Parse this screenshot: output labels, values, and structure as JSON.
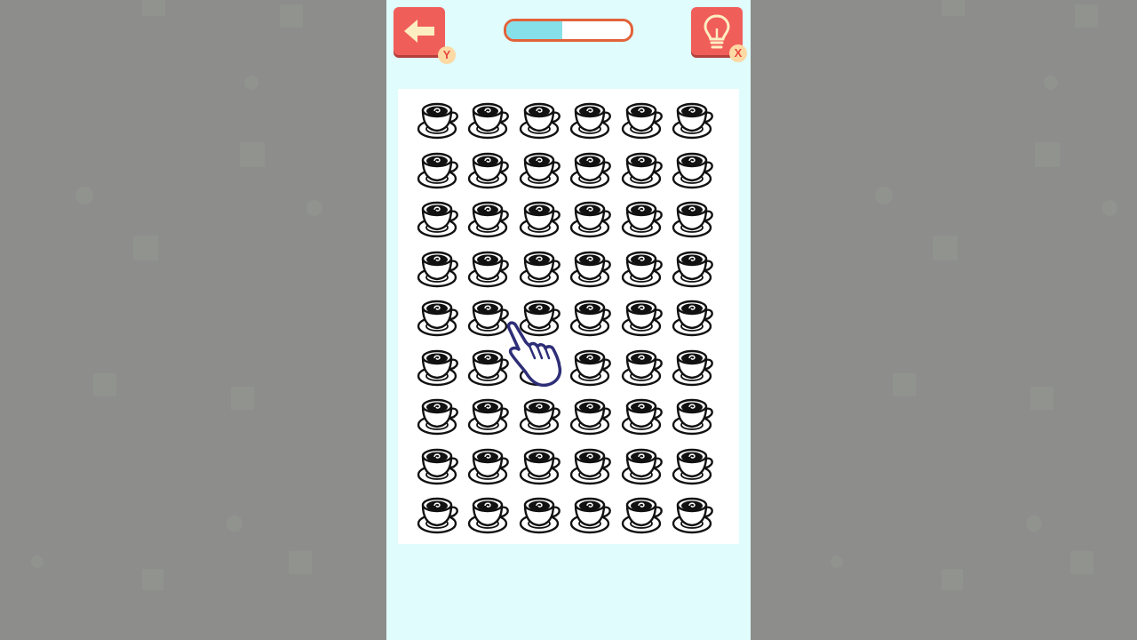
{
  "game": {
    "progress_percent": 45,
    "back_button": {
      "icon": "arrow-left-icon",
      "key_hint": "Y"
    },
    "hint_button": {
      "icon": "lightbulb-icon",
      "key_hint": "X"
    },
    "grid": {
      "rows": 9,
      "cols": 6,
      "item_icon": "coffee-cup-icon"
    },
    "pointer_icon": "pointing-hand-icon"
  },
  "colors": {
    "page_background": "#8d8e8b",
    "game_background": "#e0fcfc",
    "button_red": "#f05e5a",
    "badge_cream": "#fdd9a4",
    "progress_border": "#e2623a",
    "progress_fill": "#86e0ea",
    "hand_outline": "#2e2e78"
  }
}
